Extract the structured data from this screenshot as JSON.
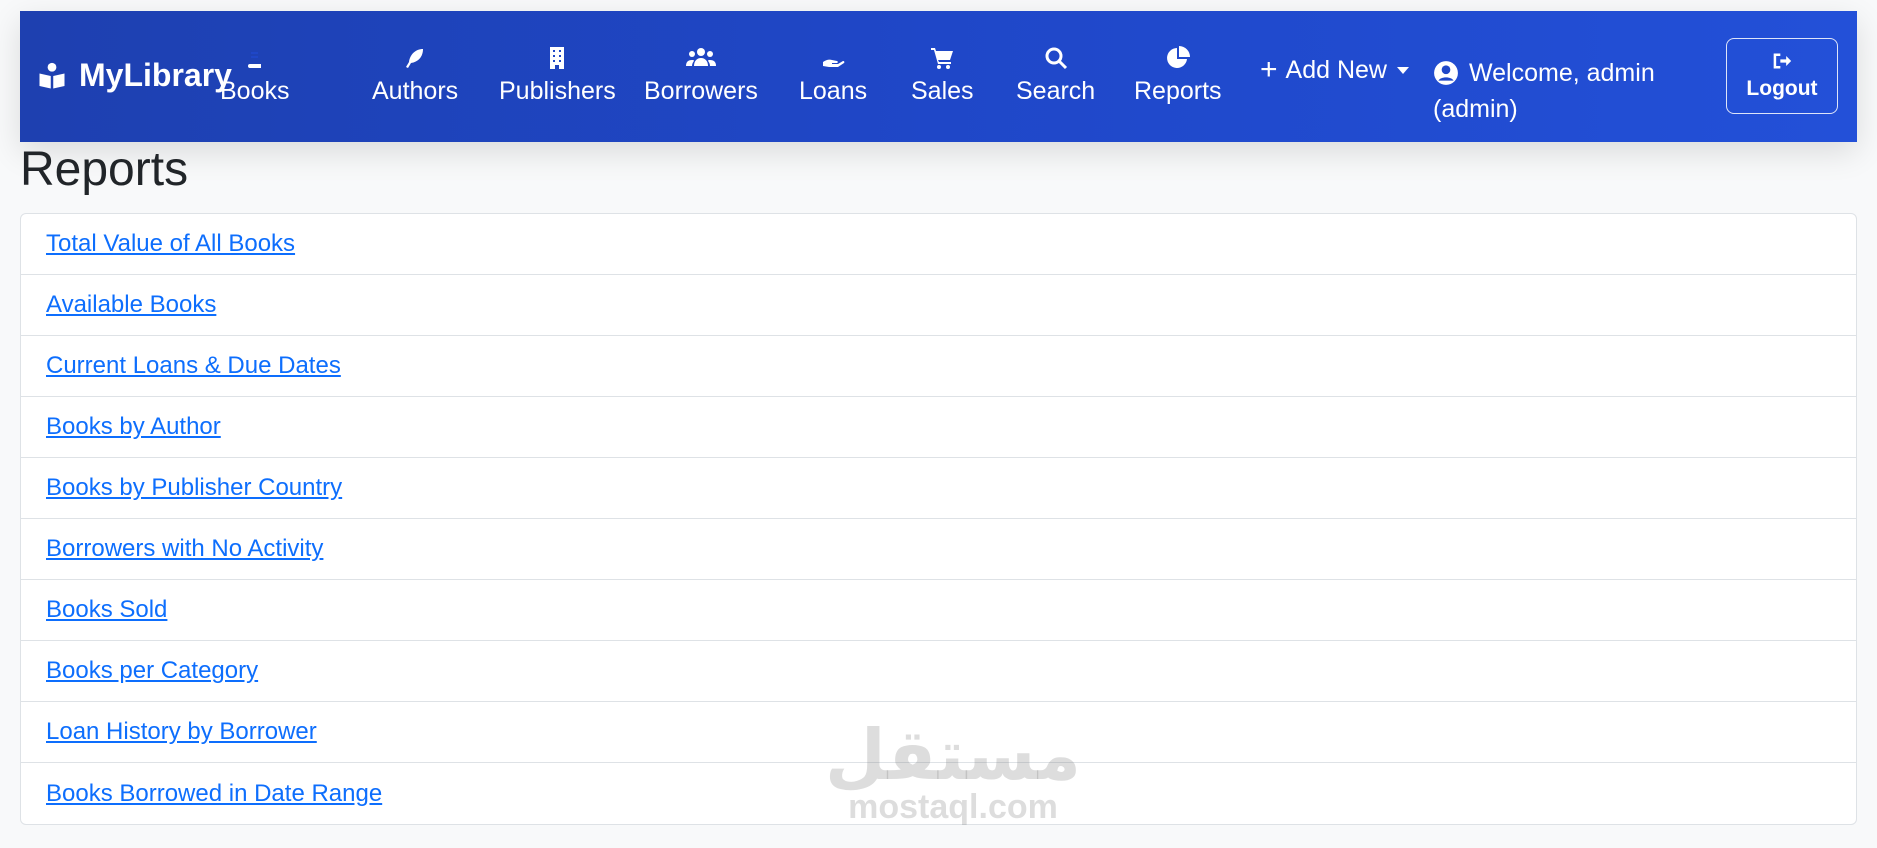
{
  "brand": {
    "name": "MyLibrary",
    "icon": "book-reader-icon"
  },
  "nav": [
    {
      "label": "Books",
      "icon": "book-icon"
    },
    {
      "label": "Authors",
      "icon": "feather-icon"
    },
    {
      "label": "Publishers",
      "icon": "building-icon"
    },
    {
      "label": "Borrowers",
      "icon": "users-icon"
    },
    {
      "label": "Loans",
      "icon": "hand-holding-icon"
    },
    {
      "label": "Sales",
      "icon": "cart-icon"
    },
    {
      "label": "Search",
      "icon": "search-icon"
    },
    {
      "label": "Reports",
      "icon": "pie-chart-icon"
    }
  ],
  "add_new": {
    "label": "Add New",
    "icon": "plus-icon"
  },
  "user": {
    "welcome": "Welcome, admin",
    "role": "(admin)",
    "icon": "user-circle-icon"
  },
  "logout": {
    "label": "Logout",
    "icon": "sign-out-icon"
  },
  "page": {
    "title": "Reports"
  },
  "reports": [
    "Total Value of All Books",
    "Available Books",
    "Current Loans & Due Dates",
    "Books by Author",
    "Books by Publisher Country",
    "Borrowers with No Activity",
    "Books Sold",
    "Books per Category",
    "Loan History by Borrower",
    "Books Borrowed in Date Range"
  ],
  "watermark": {
    "arabic": "مستقل",
    "latin": "mostaql.com"
  },
  "colors": {
    "navbar": "#1f47c8",
    "link": "#0d6efd",
    "background": "#f8f9fa"
  }
}
